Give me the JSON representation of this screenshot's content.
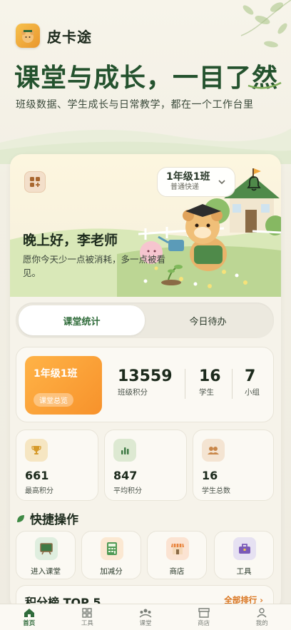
{
  "brand": {
    "name": "皮卡途"
  },
  "hero": {
    "title": "课堂与成长，一目了然",
    "subtitle": "班级数据、学生成长与日常教学，都在一个工作台里"
  },
  "card": {
    "class_selector": {
      "name": "1年级1班",
      "sub": "普通快递"
    },
    "greeting": "晚上好，李老师",
    "greeting_sub": "愿你今天少一点被消耗，多一点被看见。"
  },
  "segment": {
    "tabs": [
      "课堂统计",
      "今日待办"
    ],
    "active": 0
  },
  "stats": {
    "class_name": "1年级1班",
    "overview_label": "课堂总览",
    "items": [
      {
        "value": "13559",
        "label": "班级积分"
      },
      {
        "value": "16",
        "label": "学生"
      },
      {
        "value": "7",
        "label": "小组"
      }
    ]
  },
  "metrics": [
    {
      "value": "661",
      "label": "最高积分",
      "icon": "trophy-icon"
    },
    {
      "value": "847",
      "label": "平均积分",
      "icon": "bar-chart-icon"
    },
    {
      "value": "16",
      "label": "学生总数",
      "icon": "users-icon"
    }
  ],
  "quick": {
    "title": "快捷操作",
    "items": [
      {
        "label": "进入课堂",
        "icon": "blackboard-icon"
      },
      {
        "label": "加减分",
        "icon": "calculator-icon"
      },
      {
        "label": "商店",
        "icon": "store-icon"
      },
      {
        "label": "工具",
        "icon": "toolbox-icon"
      }
    ]
  },
  "ranking": {
    "title": "积分榜 TOP 5",
    "all_label": "全部排行"
  },
  "tabbar": {
    "items": [
      {
        "label": "首页",
        "icon": "home-icon"
      },
      {
        "label": "工具",
        "icon": "grid-icon"
      },
      {
        "label": "课堂",
        "icon": "classroom-icon"
      },
      {
        "label": "商店",
        "icon": "shop-icon"
      },
      {
        "label": "我的",
        "icon": "user-icon"
      }
    ],
    "active": 0
  },
  "colors": {
    "accent_green": "#2f6b3a",
    "accent_orange": "#f7922b",
    "link_orange": "#d9731c"
  }
}
